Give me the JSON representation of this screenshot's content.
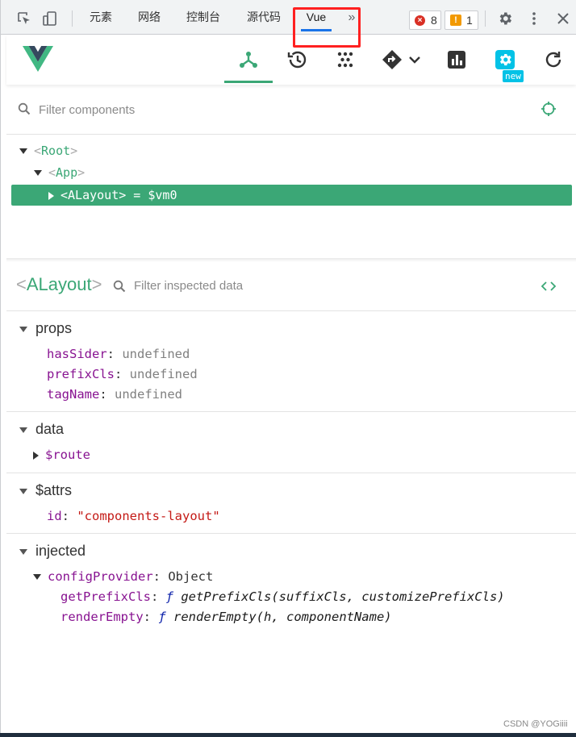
{
  "devtools": {
    "tabs": [
      "元素",
      "网络",
      "控制台",
      "源代码",
      "Vue"
    ],
    "active_tab": "Vue",
    "more_icon": "»",
    "error_count": "8",
    "warning_count": "1"
  },
  "vue_header": {
    "new_label": "new",
    "icons": [
      "components-icon",
      "history-icon",
      "vuex-icon",
      "routing-icon",
      "performance-icon",
      "settings-icon",
      "refresh-icon"
    ]
  },
  "tree": {
    "filter_placeholder": "Filter components",
    "nodes": [
      {
        "name": "Root",
        "suffix": ""
      },
      {
        "name": "App",
        "suffix": ""
      },
      {
        "name": "ALayout",
        "suffix": " = $vm0"
      }
    ]
  },
  "inspector": {
    "component_name": "ALayout",
    "filter_placeholder": "Filter inspected data",
    "sections": {
      "props": {
        "title": "props",
        "rows": [
          {
            "key": "hasSider",
            "value": "undefined"
          },
          {
            "key": "prefixCls",
            "value": "undefined"
          },
          {
            "key": "tagName",
            "value": "undefined"
          }
        ]
      },
      "data": {
        "title": "data",
        "rows": [
          {
            "key": "$route"
          }
        ]
      },
      "attrs": {
        "title": "$attrs",
        "rows": [
          {
            "key": "id",
            "value": "\"components-layout\""
          }
        ]
      },
      "injected": {
        "title": "injected",
        "provider_key": "configProvider",
        "provider_value": "Object",
        "rows": [
          {
            "key": "getPrefixCls",
            "fn": "ƒ",
            "sig": "getPrefixCls(suffixCls, customizePrefixCls)"
          },
          {
            "key": "renderEmpty",
            "fn": "ƒ",
            "sig": "renderEmpty(h, componentName)"
          }
        ]
      }
    }
  },
  "watermark": "CSDN @YOGiiii",
  "colors": {
    "vue_green": "#3ba776",
    "highlight_red": "#ff2020",
    "tab_underline": "#1a73e8"
  }
}
